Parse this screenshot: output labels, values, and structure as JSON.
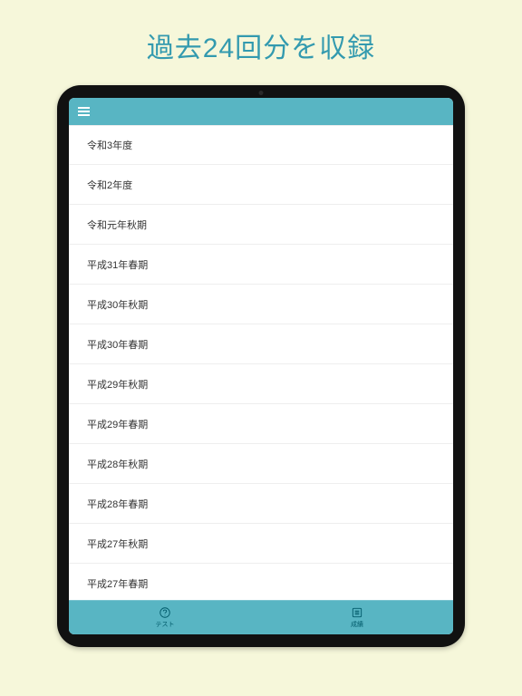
{
  "banner": "過去24回分を収録",
  "topbar": {
    "menu_label": "menu"
  },
  "list_items": [
    "令和3年度",
    "令和2年度",
    "令和元年秋期",
    "平成31年春期",
    "平成30年秋期",
    "平成30年春期",
    "平成29年秋期",
    "平成29年春期",
    "平成28年秋期",
    "平成28年春期",
    "平成27年秋期",
    "平成27年春期"
  ],
  "bottombar": {
    "tab_test": "テスト",
    "tab_score": "成績"
  },
  "colors": {
    "background": "#f6f7da",
    "accent": "#58b5c3",
    "banner_text": "#339aaf"
  }
}
